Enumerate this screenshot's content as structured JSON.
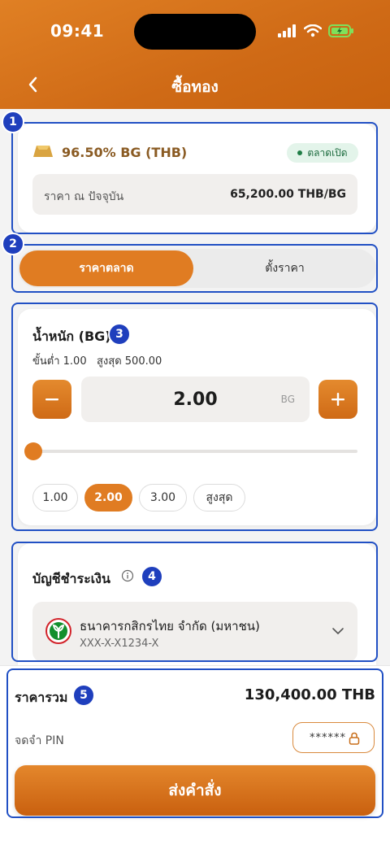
{
  "status_bar": {
    "time": "09:41"
  },
  "header": {
    "title": "ซื้อทอง"
  },
  "gold": {
    "name": "96.50% BG (THB)",
    "market_status": "ตลาดเปิด",
    "price_label": "ราคา ณ ปัจจุบัน",
    "price_value": "65,200.00 THB/BG"
  },
  "order_type": {
    "tabs": [
      "ราคาตลาด",
      "ตั้งราคา"
    ],
    "selected": "ราคาตลาด"
  },
  "weight": {
    "title": "น้ำหนัก (BG)",
    "range": "ขั้นต่ำ 1.00   สูงสุด 500.00",
    "value": "2.00",
    "unit": "BG",
    "slider_level": 0.002,
    "presets": [
      "1.00",
      "2.00",
      "3.00",
      "สูงสุด"
    ],
    "selected_preset": "2.00"
  },
  "account": {
    "title": "บัญชีชำระเงิน",
    "bank_name": "ธนาคารกสิกรไทย จำกัด (มหาชน)",
    "account_number": "XXX-X-X1234-X"
  },
  "summary": {
    "total_label": "ราคารวม",
    "total_value": "130,400.00 THB",
    "pin_label": "จดจำ PIN",
    "pin_mask": "******",
    "submit_label": "ส่งคำสั่ง"
  },
  "annotations": {
    "badges": [
      "1",
      "2",
      "3",
      "4",
      "5"
    ]
  },
  "colors": {
    "accent": "#e07c22",
    "annotation": "#1f3fbd",
    "market_open": "#1f7d46",
    "bank": "#138f2d"
  }
}
